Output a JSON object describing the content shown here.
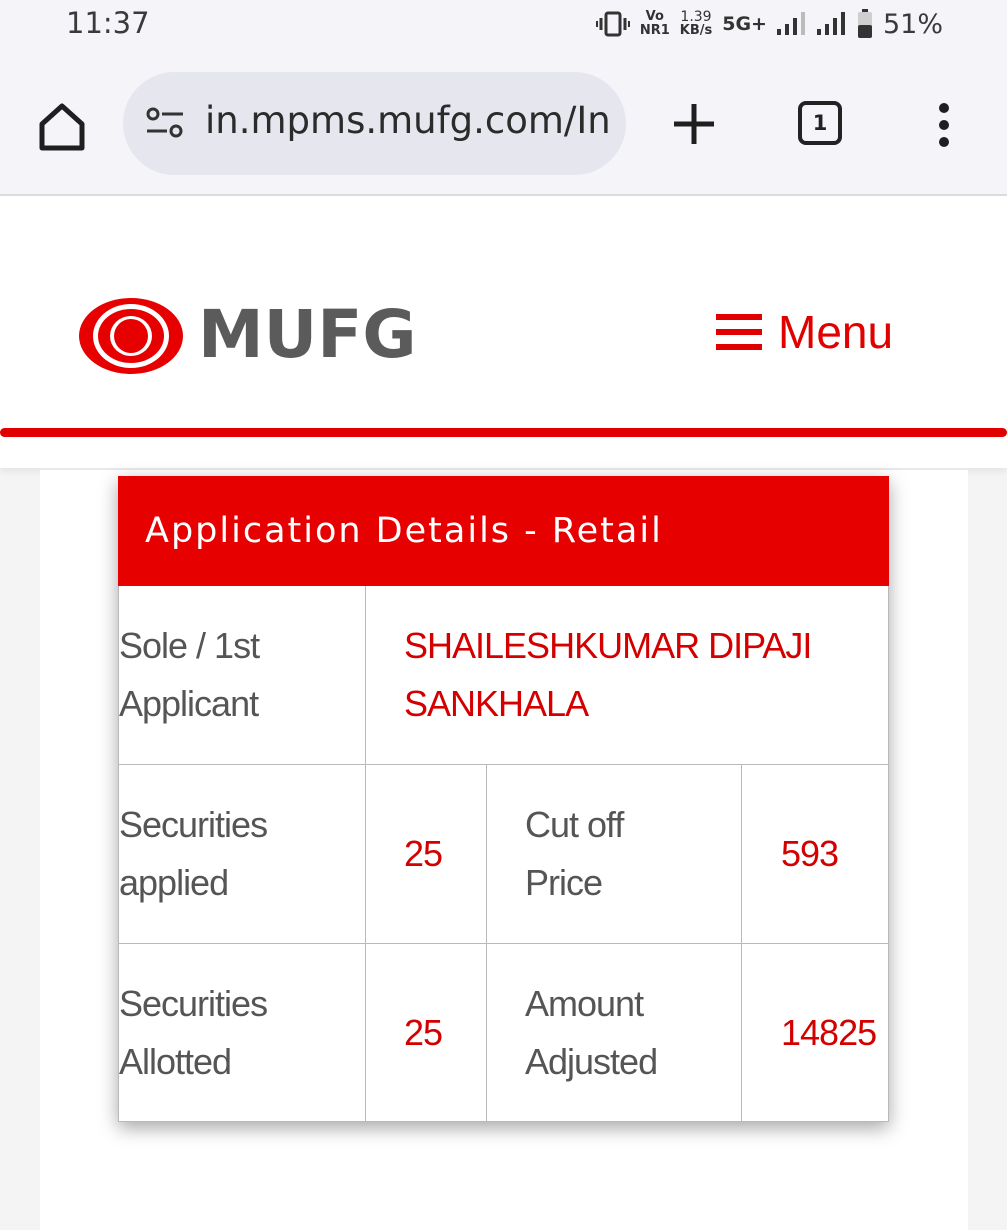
{
  "status_bar": {
    "time": "11:37",
    "volte": "Vo",
    "nr": "NR1",
    "speed_value": "1.39",
    "speed_unit": "KB/s",
    "network": "5G+",
    "battery": "51%"
  },
  "browser": {
    "url": "in.mpms.mufg.com/In",
    "tab_count": "1"
  },
  "site": {
    "logo_text": "MUFG",
    "menu_label": "Menu",
    "brand_color": "#e60000"
  },
  "details": {
    "title": "Application Details - Retail",
    "applicant_label": "Sole / 1st Applicant",
    "applicant_name": "SHAILESHKUMAR DIPAJI SANKHALA",
    "securities_applied_label": "Securities applied",
    "securities_applied": "25",
    "cutoff_label": "Cut off Price",
    "cutoff_price": "593",
    "securities_allotted_label": "Securities Allotted",
    "securities_allotted": "25",
    "amount_adjusted_label": "Amount Adjusted",
    "amount_adjusted": "14825"
  }
}
